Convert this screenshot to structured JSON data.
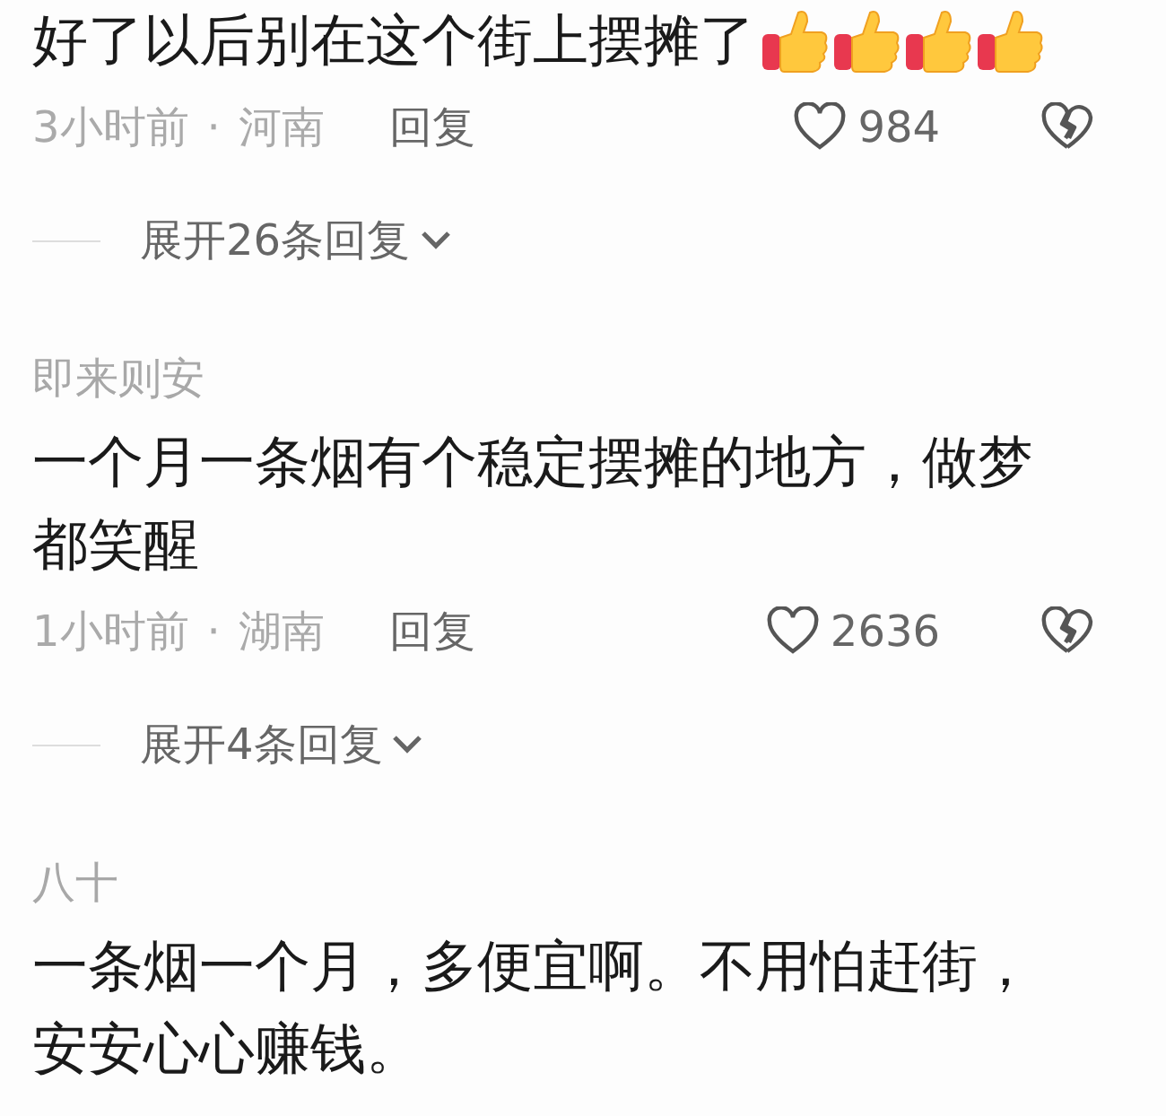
{
  "comments": [
    {
      "text": "好了以后别在这个街上摆摊了",
      "emojis": [
        {
          "kind": "thumbs-up"
        },
        {
          "kind": "thumbs-up"
        },
        {
          "kind": "thumbs-up"
        },
        {
          "kind": "thumbs-up"
        }
      ],
      "time": "3小时前",
      "separator": "·",
      "region": "河南",
      "reply_label": "回复",
      "likes": "984",
      "expand_label": "展开26条回复"
    },
    {
      "author": "即来则安",
      "text": "一个月一条烟有个稳定摆摊的地方，做梦都笑醒",
      "time": "1小时前",
      "separator": "·",
      "region": "湖南",
      "reply_label": "回复",
      "likes": "2636",
      "expand_label": "展开4条回复"
    },
    {
      "author": "八十",
      "text": "一条烟一个月，多便宜啊。不用怕赶街，安安心心赚钱。"
    }
  ]
}
